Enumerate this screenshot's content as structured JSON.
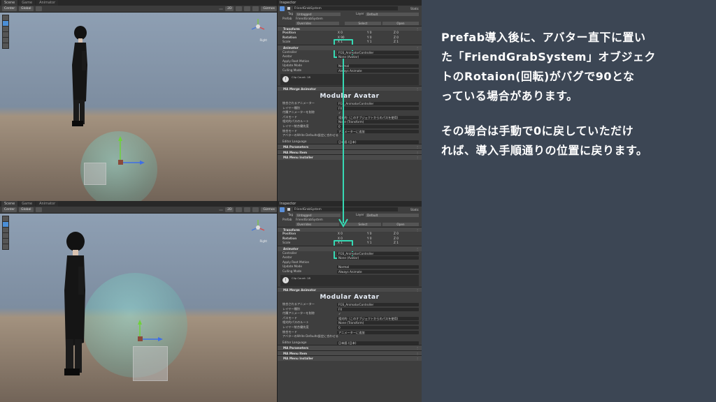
{
  "scene_tabs": [
    "Scene",
    "Game",
    "Animator"
  ],
  "toolbar": {
    "pivot": "Center",
    "space": "Global",
    "mode": "2D",
    "gizmos": "Gizmos"
  },
  "gizmo_label": "Right",
  "top": {
    "inspector_title": "Inspector",
    "object_name": "FriendGrabSystem",
    "static_label": "Static",
    "tag_label": "Tag",
    "tag_value": "Untagged",
    "layer_label": "Layer",
    "layer_value": "Default",
    "prefab_label": "Prefab",
    "prefab_value": "FriendGrabSystem",
    "overrides": "Overrides",
    "select": "Select",
    "open": "Open",
    "transform": "Transform",
    "position_label": "Position",
    "rotation_label": "Rotation",
    "scale_label": "Scale",
    "pos": [
      "0",
      "0",
      "0"
    ],
    "rot": [
      "90",
      "0",
      "0"
    ],
    "scl": [
      "1",
      "1",
      "1"
    ],
    "animator": "Animator",
    "anim_rows": [
      {
        "label": "Controller",
        "value": "FGS_AnimatorController"
      },
      {
        "label": "Avatar",
        "value": "None (Avatar)"
      },
      {
        "label": "Apply Root Motion",
        "value": ""
      },
      {
        "label": "Update Mode",
        "value": "Normal"
      },
      {
        "label": "Culling Mode",
        "value": "Always Animate"
      }
    ],
    "clip_info": "Clip Count: 18",
    "merge_title": "MA Merge Animator",
    "logo": "Modular Avatar",
    "merge_rows": [
      {
        "label": "統合されるアニメーター",
        "value": "FGS_AnimatorController"
      },
      {
        "label": "レイヤー種別",
        "value": "FX"
      },
      {
        "label": "付属アニメーターを削除",
        "value": "✓"
      },
      {
        "label": "パスモード",
        "value": "相対的（このオブジェクトからのパスを使用）"
      },
      {
        "label": "相対的パスのルート",
        "value": "None (Transform)"
      },
      {
        "label": "レイヤー統合優先度",
        "value": "0"
      },
      {
        "label": "統合モード",
        "value": "アニメーターに追加"
      },
      {
        "label": "アバターのWrite Defaults設定に合わせる",
        "value": ""
      }
    ],
    "editor_lang_label": "Editor Language",
    "editor_lang_value": "日本語 (日本)",
    "bottom_comps": [
      "MA Parameters",
      "MA Menu Item",
      "MA Menu Installer"
    ]
  },
  "bottom": {
    "rot": [
      "0",
      "0",
      "0"
    ]
  },
  "explanation": {
    "para1": [
      "Prefab導入後に、アバター直下に置い",
      "た「FriendGrabSystem」オブジェク",
      "トのRotaion(回転)がバグで90とな",
      "っている場合があります。"
    ],
    "para2": [
      "その場合は手動で0に戻していただけ",
      "れば、導入手順通りの位置に戻ります。"
    ]
  },
  "colors": {
    "highlight": "#36d9b4",
    "background": "#3c4654",
    "arrow": "#36d9b4"
  }
}
